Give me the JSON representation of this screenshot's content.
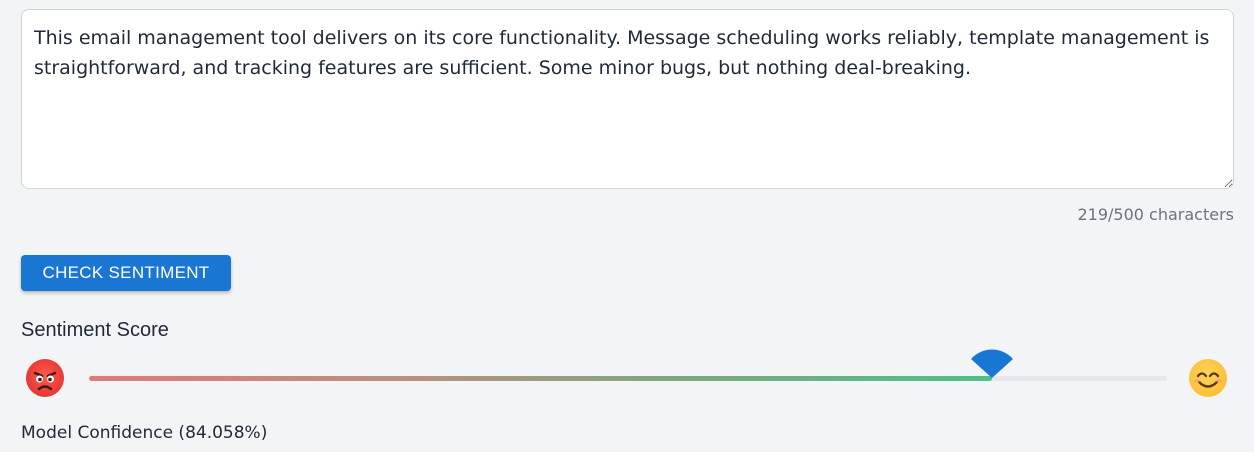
{
  "review": {
    "text": "This email management tool delivers on its core functionality. Message scheduling works reliably, template management is straightforward, and tracking features are sufficient. Some minor bugs, but nothing deal-breaking."
  },
  "char_count": "219/500 characters",
  "check_button_label": "CHECK SENTIMENT",
  "sentiment": {
    "label": "Sentiment Score",
    "score_fraction": 0.838,
    "left_icon": "angry-face-icon",
    "right_icon": "smiling-face-icon"
  },
  "confidence_label": "Model Confidence (84.058%)",
  "colors": {
    "accent": "#1976d2",
    "thumb": "#1976d2",
    "fill_start": "#e07a7a",
    "fill_end": "#4cc08a",
    "background": "#f3f4f6"
  }
}
